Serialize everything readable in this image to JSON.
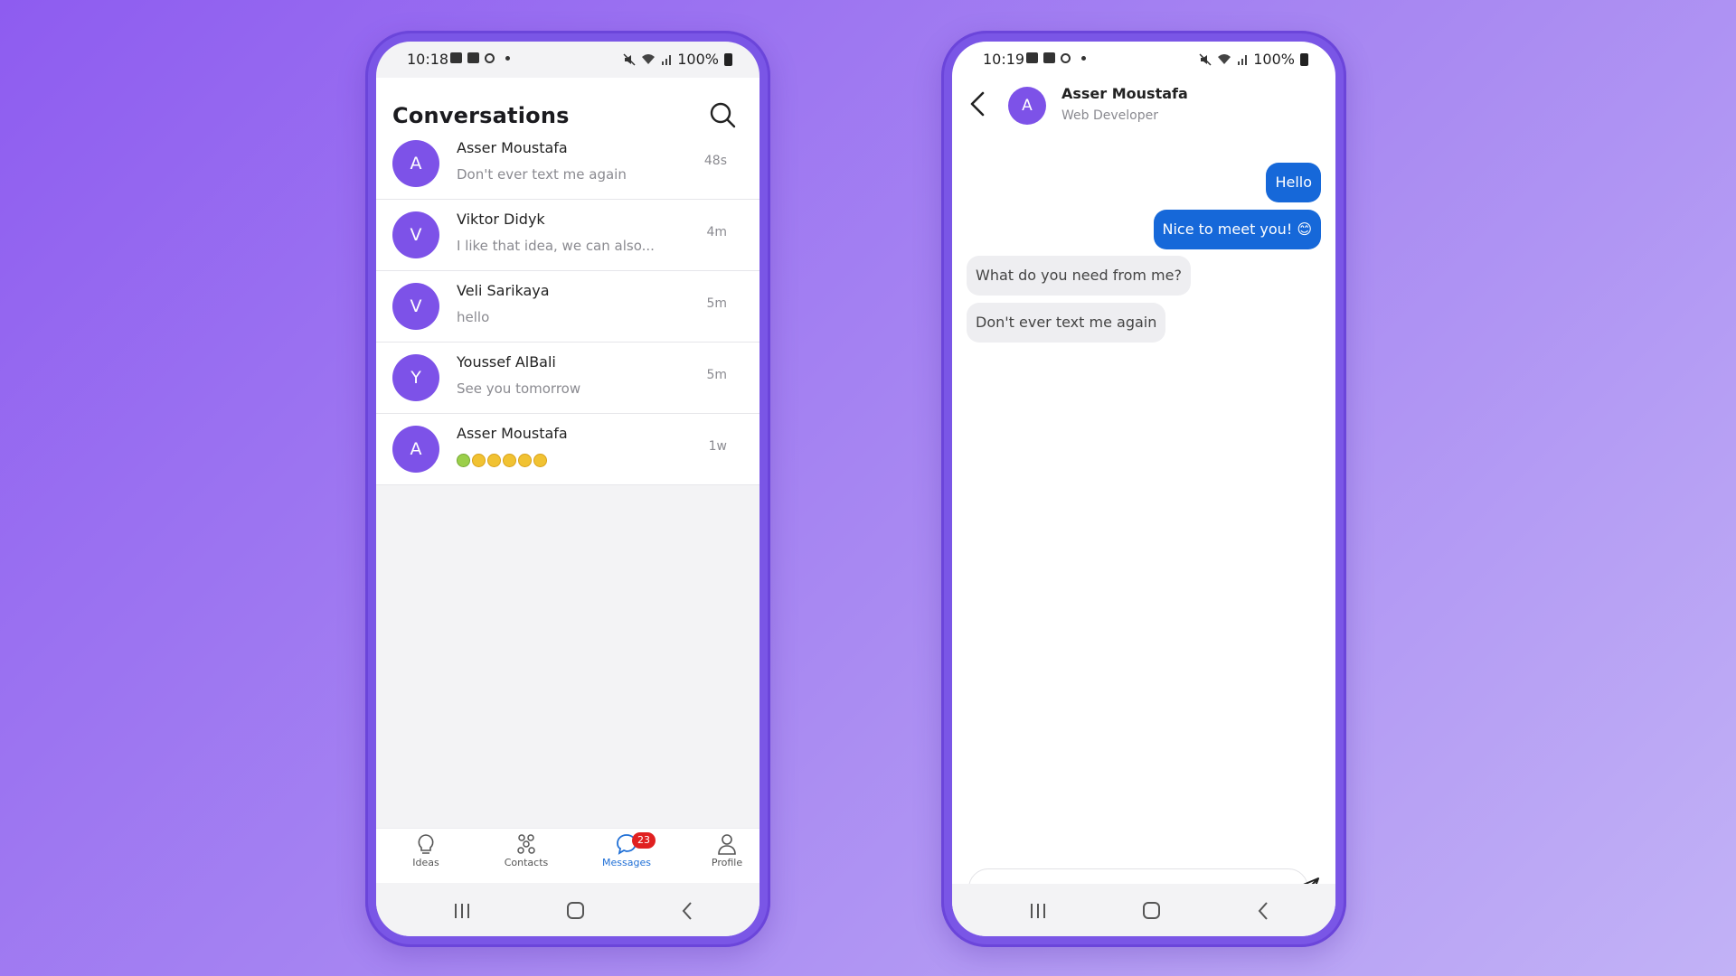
{
  "left_phone": {
    "status": {
      "time": "10:18",
      "battery": "100%"
    },
    "header": {
      "title": "Conversations"
    },
    "conversations": [
      {
        "initial": "A",
        "name": "Asser Moustafa",
        "message": "Don't ever text me again",
        "time": "48s"
      },
      {
        "initial": "V",
        "name": "Viktor Didyk",
        "message": "I like that idea, we can also...",
        "time": "4m"
      },
      {
        "initial": "V",
        "name": "Veli Sarikaya",
        "message": "hello",
        "time": "5m"
      },
      {
        "initial": "Y",
        "name": "Youssef AlBali",
        "message": "See you tomorrow",
        "time": "5m"
      },
      {
        "initial": "A",
        "name": "Asser Moustafa",
        "message": "",
        "time": "1w"
      }
    ],
    "tabs": [
      {
        "label": "Ideas",
        "icon": "lightbulb-icon"
      },
      {
        "label": "Contacts",
        "icon": "contacts-icon"
      },
      {
        "label": "Messages",
        "icon": "chat-bubble-icon",
        "badge": "23",
        "active": true
      },
      {
        "label": "Profile",
        "icon": "person-icon"
      }
    ]
  },
  "right_phone": {
    "status": {
      "time": "10:19",
      "battery": "100%"
    },
    "chat": {
      "initial": "A",
      "name": "Asser Moustafa",
      "subtitle": "Web Developer"
    },
    "messages": [
      {
        "from": "me",
        "text": "Hello"
      },
      {
        "from": "me",
        "text": "Nice to meet you! 😊"
      },
      {
        "from": "them",
        "text": "What do you need from me?"
      },
      {
        "from": "them",
        "text": "Don't ever text me again"
      }
    ],
    "composer": {
      "placeholder": ""
    }
  },
  "colors": {
    "accent_purple": "#7d52e8",
    "message_blue": "#1668d9",
    "badge_red": "#e02020"
  }
}
